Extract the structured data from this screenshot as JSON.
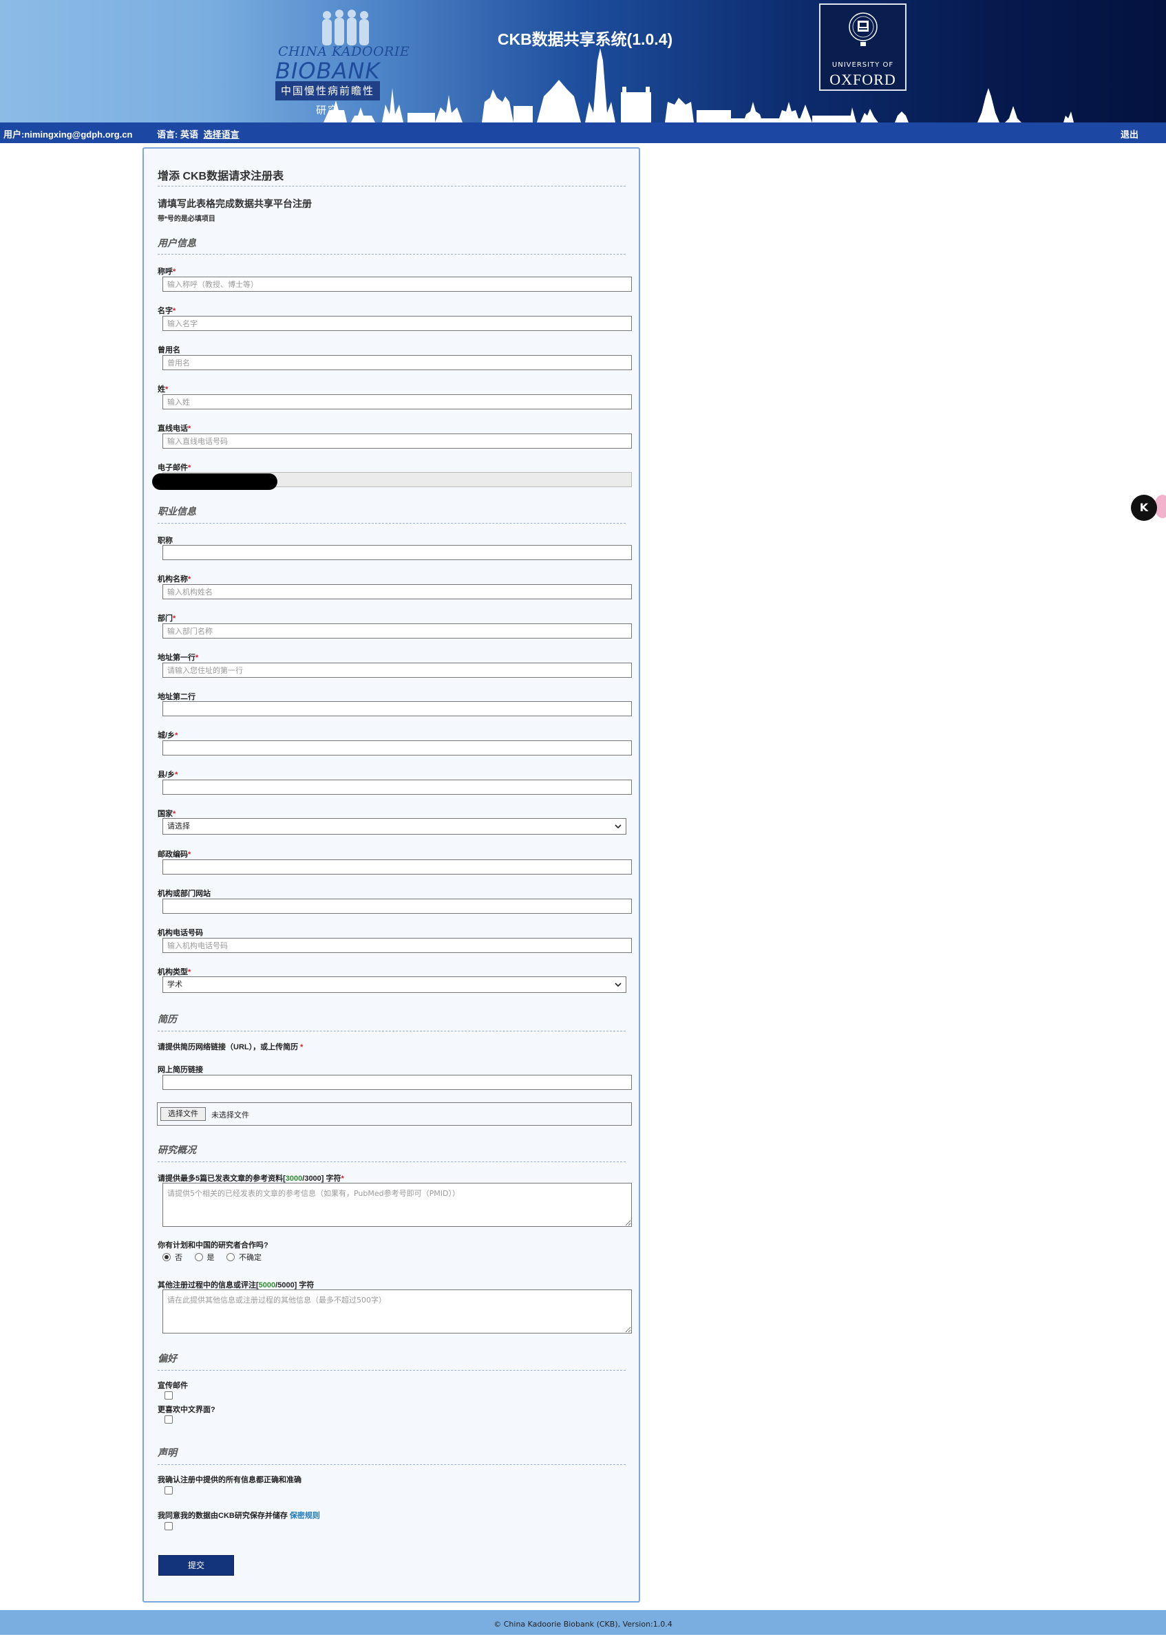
{
  "header": {
    "logo": {
      "line1": "CHINA KADOORIE",
      "line2": "BIOBANK",
      "chinese": "中国慢性病前瞻性研究"
    },
    "title": "CKB数据共享系统(1.0.4)",
    "oxford": {
      "university_of": "UNIVERSITY OF",
      "name": "OXFORD"
    },
    "colors": {
      "banner_dark": "#04123f",
      "banner_light": "#8dbbe6",
      "userbar": "#1c48a4"
    }
  },
  "userbar": {
    "user": "用户:nimingxing@gdph.org.cn",
    "language": "语言: 英语",
    "choose_language": "选择语言",
    "logout": "退出"
  },
  "form": {
    "title": "增添 CKB数据请求注册表",
    "intro": "请填写此表格完成数据共享平台注册",
    "required_note": "带*号的是必填项目",
    "sections": {
      "user_info": "用户信息",
      "career": "职业信息",
      "cv": "简历",
      "research": "研究概况",
      "preferences": "偏好",
      "declaration": "声明"
    },
    "fields": {
      "salutation": {
        "label": "称呼",
        "placeholder": "输入称呼（教授、博士等）"
      },
      "first_name": {
        "label": "名字",
        "placeholder": "输入名字"
      },
      "used_name": {
        "label": "曾用名",
        "placeholder": "曾用名"
      },
      "last_name": {
        "label": "姓",
        "placeholder": "输入姓"
      },
      "phone": {
        "label": "直线电话",
        "placeholder": "输入直线电话号码"
      },
      "email": {
        "label": "电子邮件",
        "value": ""
      },
      "job_title": {
        "label": "职称",
        "value": ""
      },
      "org_name": {
        "label": "机构名称",
        "placeholder": "输入机构姓名"
      },
      "department": {
        "label": "部门",
        "placeholder": "输入部门名称"
      },
      "address1": {
        "label": "地址第一行",
        "placeholder": "请输入您住址的第一行"
      },
      "address2": {
        "label": "地址第二行",
        "value": ""
      },
      "city": {
        "label": "城/乡",
        "value": ""
      },
      "county": {
        "label": "县/乡",
        "value": ""
      },
      "country": {
        "label": "国家",
        "selected": "请选择"
      },
      "postcode": {
        "label": "邮政编码",
        "value": ""
      },
      "org_website": {
        "label": "机构或部门网站",
        "value": ""
      },
      "org_phone": {
        "label": "机构电话号码",
        "placeholder": "输入机构电话号码"
      },
      "org_type": {
        "label": "机构类型",
        "selected": "学术"
      }
    },
    "cv": {
      "prompt": "请提供简历网络链接（URL），或上传简历",
      "link_label": "网上简历链接",
      "file_button": "选择文件",
      "file_status": "未选择文件"
    },
    "research": {
      "refs_label_prefix": "请提供最多5篇已发表文章的参考资料[",
      "refs_count": "3000",
      "refs_label_suffix": "/3000] 字符",
      "refs_placeholder": "请提供5个相关的已经发表的文章的参考信息（如果有，PubMed参考号即可（PMID））",
      "collab_question": "你有计划和中国的研究者合作吗?",
      "collab_options": [
        "否",
        "是",
        "不确定"
      ],
      "collab_selected": "否",
      "other_label_prefix": "其他注册过程中的信息或评注[",
      "other_count": "5000",
      "other_label_suffix": "/5000] 字符",
      "other_placeholder": "请在此提供其他信息或注册过程的其他信息（最多不超过500字）"
    },
    "preferences": {
      "promo_email": "宣传邮件",
      "prefer_chinese": "更喜欢中文界面?"
    },
    "declaration": {
      "confirm_accurate": "我确认注册中提供的所有信息都正确和准确",
      "consent_store": "我同意我的数据由CKB研究保存并储存",
      "privacy_link": "保密规则"
    },
    "submit": "提交"
  },
  "footer": {
    "text": "© China Kadoorie Biobank (CKB), Version:1.0.4"
  },
  "widget": {
    "label": "K",
    "icon": "assistant-widget-icon"
  }
}
